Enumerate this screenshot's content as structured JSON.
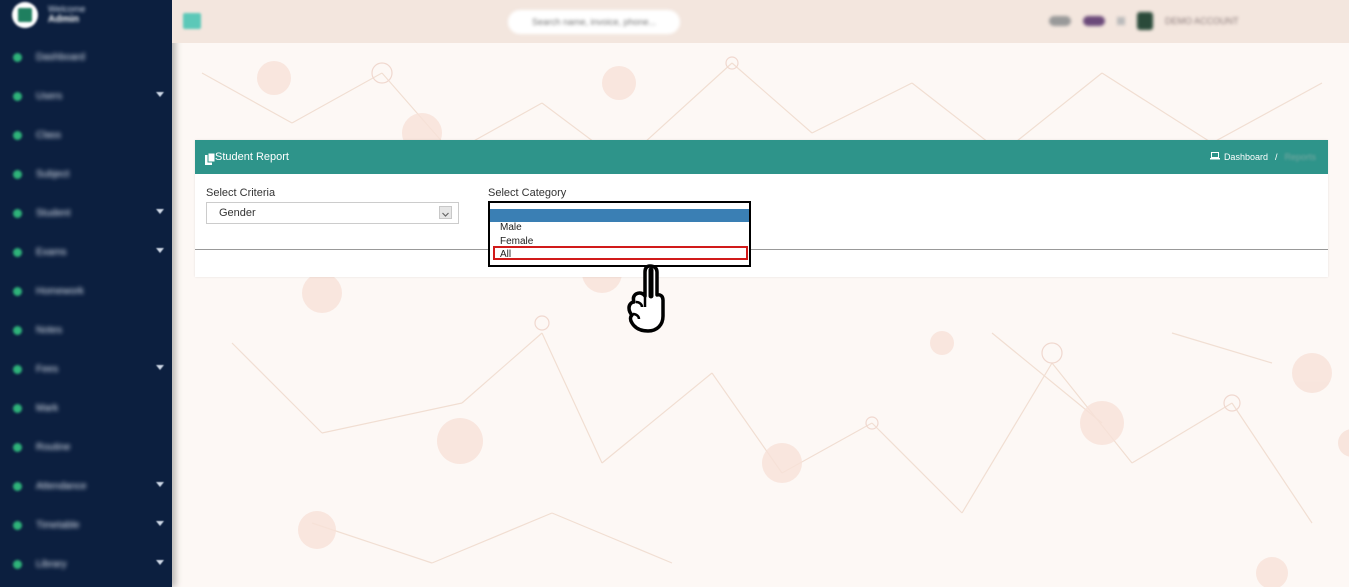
{
  "sidebar": {
    "welcome": "Welcome",
    "role": "Admin",
    "items": [
      {
        "label": "Dashboard",
        "caret": false
      },
      {
        "label": "Users",
        "caret": true
      },
      {
        "label": "Class",
        "caret": false
      },
      {
        "label": "Subject",
        "caret": false
      },
      {
        "label": "Student",
        "caret": true
      },
      {
        "label": "Exams",
        "caret": true
      },
      {
        "label": "Homework",
        "caret": false
      },
      {
        "label": "Notes",
        "caret": false
      },
      {
        "label": "Fees",
        "caret": true
      },
      {
        "label": "Mark",
        "caret": false
      },
      {
        "label": "Routine",
        "caret": false
      },
      {
        "label": "Attendance",
        "caret": true
      },
      {
        "label": "Timetable",
        "caret": true
      },
      {
        "label": "Library",
        "caret": true
      }
    ]
  },
  "topbar": {
    "search_placeholder": "Search name, invoice, phone...",
    "account": "DEMO ACCOUNT"
  },
  "panel": {
    "title": "Student Report",
    "breadcrumb_home": "Dashboard",
    "breadcrumb_sep": "/",
    "breadcrumb_current": "Reports"
  },
  "form": {
    "criteria_label": "Select Criteria",
    "criteria_value": "Gender",
    "category_label": "Select Category",
    "category_options": [
      "Male",
      "Female",
      "All"
    ]
  },
  "colors": {
    "sidebar_bg": "#0c1f3f",
    "header_teal": "#2e948a",
    "dropdown_selected": "#3a7fb4",
    "highlight": "#d11a1a"
  }
}
